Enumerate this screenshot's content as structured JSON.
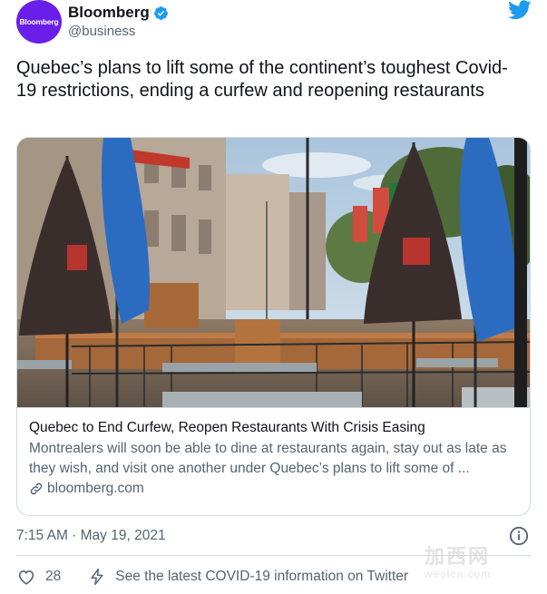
{
  "author": {
    "avatar_text": "Bloomberg",
    "display_name": "Bloomberg",
    "handle": "@business",
    "avatar_color": "#6a1eea",
    "verified_color": "#1d9bf0"
  },
  "tweet": {
    "text": "Quebec’s plans to lift some of the continent’s toughest Covid-19 restrictions, ending a curfew and reopening restaurants"
  },
  "card": {
    "title": "Quebec to End Curfew, Reopen Restaurants With Crisis Easing",
    "description": "Montrealers will soon be able to dine at restaurants again, stay out as late as they wish, and visit one another under Quebec’s plans to lift some of ...",
    "domain": "bloomberg.com"
  },
  "meta": {
    "timestamp": "7:15 AM · May 19, 2021",
    "like_count": "28",
    "covid_link": "See the latest COVID-19 information on Twitter"
  },
  "watermark": {
    "main": "加西网",
    "sub": "westca.com"
  },
  "colors": {
    "text_primary": "#0f1419",
    "text_secondary": "#536471",
    "twitter_blue": "#1d9bf0",
    "border": "#cfd9de"
  },
  "icons": {
    "verified": "verified-badge-icon",
    "logo": "twitter-bird-icon",
    "info": "info-icon",
    "link": "link-icon",
    "like": "heart-icon",
    "covid": "lightning-icon"
  }
}
